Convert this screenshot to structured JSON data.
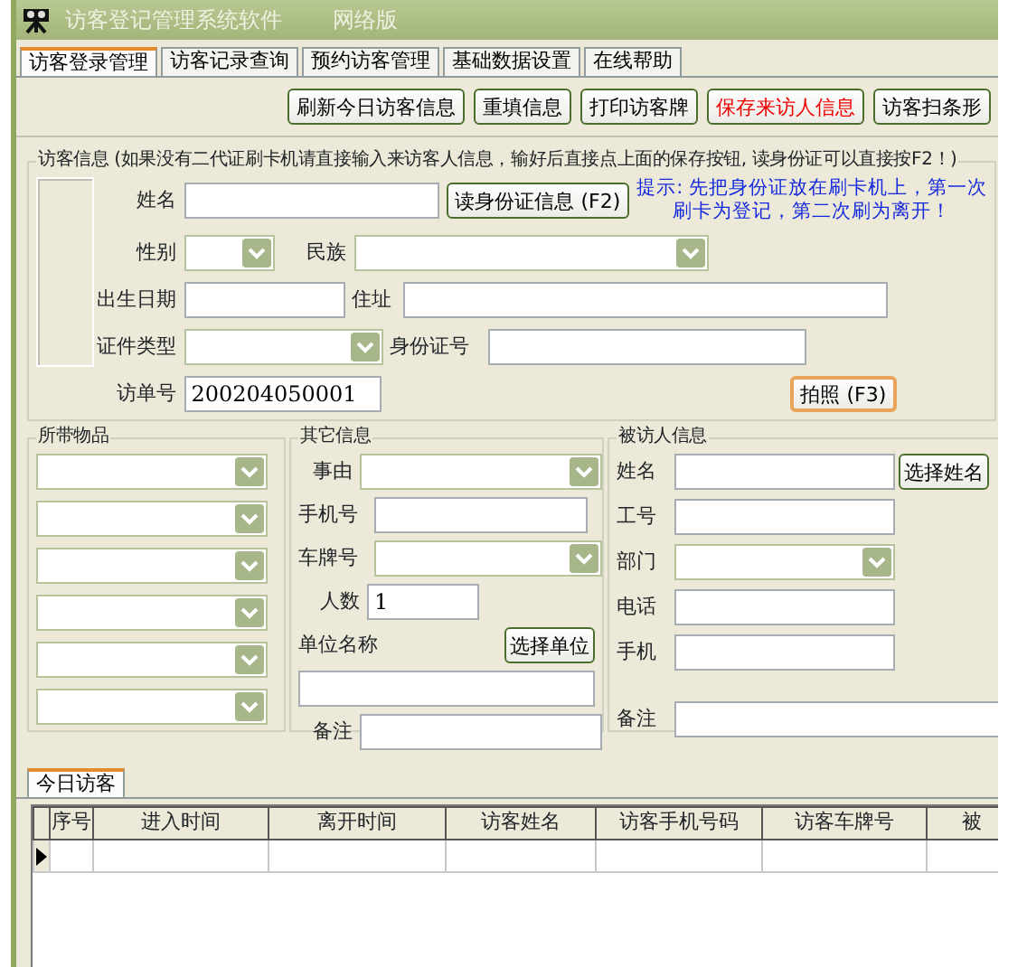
{
  "window": {
    "title": "访客登记管理系统软件",
    "edition": "网络版"
  },
  "tabs": [
    {
      "label": "访客登录管理",
      "selected": true
    },
    {
      "label": "访客记录查询",
      "selected": false
    },
    {
      "label": "预约访客管理",
      "selected": false
    },
    {
      "label": "基础数据设置",
      "selected": false
    },
    {
      "label": "在线帮助",
      "selected": false
    }
  ],
  "toolbar": [
    {
      "label": "刷新今日访客信息",
      "kind": "normal"
    },
    {
      "label": "重填信息",
      "kind": "normal"
    },
    {
      "label": "打印访客牌",
      "kind": "normal"
    },
    {
      "label": "保存来访人信息",
      "kind": "save"
    },
    {
      "label": "访客扫条形",
      "kind": "normal"
    }
  ],
  "visitor_info": {
    "legend": "访客信息 (如果没有二代证刷卡机请直接输入来访客人信息，输好后直接点上面的保存按钮, 读身份证可以直接按F2！)",
    "fields": [
      {
        "label": "姓名",
        "kind": "input"
      },
      {
        "label": "性别",
        "kind": "select"
      },
      {
        "label": "民族",
        "kind": "select"
      },
      {
        "label": "出生日期",
        "kind": "input"
      },
      {
        "label": "住址",
        "kind": "input"
      },
      {
        "label": "证件类型",
        "kind": "select"
      },
      {
        "label": "身份证号",
        "kind": "input"
      },
      {
        "label": "访单号",
        "kind": "input",
        "value": "200204050001"
      }
    ],
    "read_button": "读身份证信息 (F2)",
    "hint": [
      "提示: 先把身份证放在刷卡机上，第一次",
      "刷卡为登记，第二次刷为离开！"
    ],
    "photo_button": "拍照 (F3)"
  },
  "items": {
    "legend": "所带物品",
    "fields": [
      {
        "kind": "select"
      },
      {
        "kind": "select"
      },
      {
        "kind": "select"
      },
      {
        "kind": "select"
      },
      {
        "kind": "select"
      },
      {
        "kind": "select"
      }
    ]
  },
  "other_info": {
    "legend": "其它信息",
    "fields": [
      {
        "label": "事由",
        "kind": "select"
      },
      {
        "label": "手机号",
        "kind": "input"
      },
      {
        "label": "车牌号",
        "kind": "select"
      },
      {
        "label": "人数",
        "kind": "input",
        "value": "1"
      },
      {
        "label": "单位名称",
        "kind": "input"
      },
      {
        "label": "备注",
        "kind": "input"
      }
    ],
    "unit_button": "选择单位"
  },
  "host_info": {
    "legend": "被访人信息",
    "fields": [
      {
        "label": "姓名",
        "kind": "input"
      },
      {
        "label": "工号",
        "kind": "input"
      },
      {
        "label": "部门",
        "kind": "select"
      },
      {
        "label": "电话",
        "kind": "input"
      },
      {
        "label": "手机",
        "kind": "input"
      },
      {
        "label": "备注",
        "kind": "input"
      }
    ],
    "name_button": "选择姓名"
  },
  "today": {
    "tab": "今日访客",
    "columns": [
      "序号",
      "进入时间",
      "离开时间",
      "访客姓名",
      "访客手机号码",
      "访客车牌号",
      "被"
    ],
    "rows": [
      {
        "current": true
      }
    ]
  }
}
